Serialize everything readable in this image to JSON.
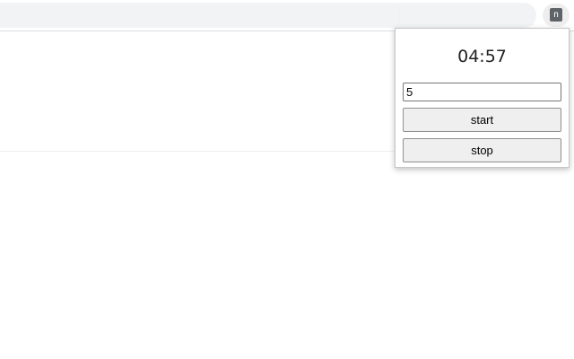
{
  "extension": {
    "icon_name": "n-icon",
    "icon_letter": "n"
  },
  "popup": {
    "timer_display": "04:57",
    "minutes_input_value": "5",
    "start_label": "start",
    "stop_label": "stop"
  },
  "colors": {
    "omnibox_bg": "#f1f3f4",
    "button_bg": "#efefef",
    "extension_icon_bg": "#5f6368"
  }
}
